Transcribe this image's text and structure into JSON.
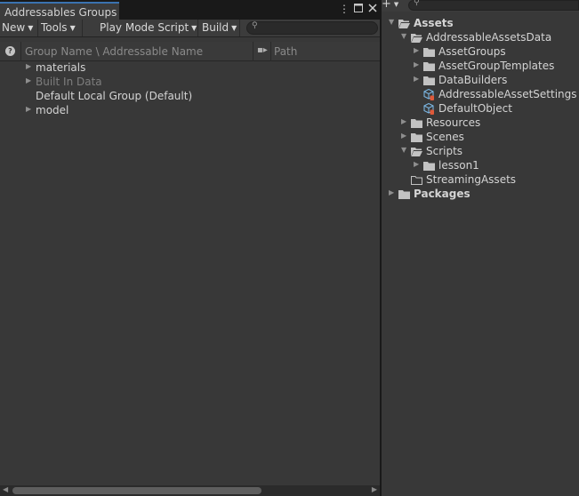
{
  "window": {
    "tab_title": "Addressables Groups",
    "tab_menu_icon": "kebab-menu-icon",
    "maximize_icon": "maximize-icon",
    "close_icon": "close-icon"
  },
  "toolbar": {
    "new_label": "New",
    "tools_label": "Tools",
    "play_mode_label": "Play Mode Script",
    "build_label": "Build",
    "search_placeholder": ""
  },
  "columns": {
    "help_label": "?",
    "group_name": "Group Name \\ Addressable Name",
    "path": "Path"
  },
  "groups": [
    {
      "label": "materials",
      "expandable": true,
      "dim": false
    },
    {
      "label": "Built In Data",
      "expandable": true,
      "dim": true
    },
    {
      "label": "Default Local Group (Default)",
      "expandable": false,
      "dim": false
    },
    {
      "label": "model",
      "expandable": true,
      "dim": false
    }
  ],
  "project": {
    "create_label": "+",
    "search_placeholder": "",
    "tree": [
      {
        "label": "Assets",
        "depth": 0,
        "arrow": "down",
        "icon": "folder-open-icon",
        "bold": true
      },
      {
        "label": "AddressableAssetsData",
        "depth": 1,
        "arrow": "down",
        "icon": "folder-open-icon",
        "bold": false
      },
      {
        "label": "AssetGroups",
        "depth": 2,
        "arrow": "right",
        "icon": "folder-icon",
        "bold": false
      },
      {
        "label": "AssetGroupTemplates",
        "depth": 2,
        "arrow": "right",
        "icon": "folder-icon",
        "bold": false
      },
      {
        "label": "DataBuilders",
        "depth": 2,
        "arrow": "right",
        "icon": "folder-icon",
        "bold": false
      },
      {
        "label": "AddressableAssetSettings",
        "depth": 2,
        "arrow": "",
        "icon": "scriptable-object-icon",
        "bold": false
      },
      {
        "label": "DefaultObject",
        "depth": 2,
        "arrow": "",
        "icon": "scriptable-object-icon",
        "bold": false
      },
      {
        "label": "Resources",
        "depth": 1,
        "arrow": "right",
        "icon": "folder-icon",
        "bold": false
      },
      {
        "label": "Scenes",
        "depth": 1,
        "arrow": "right",
        "icon": "folder-icon",
        "bold": false
      },
      {
        "label": "Scripts",
        "depth": 1,
        "arrow": "down",
        "icon": "folder-open-icon",
        "bold": false
      },
      {
        "label": "lesson1",
        "depth": 2,
        "arrow": "right",
        "icon": "folder-icon",
        "bold": false
      },
      {
        "label": "StreamingAssets",
        "depth": 1,
        "arrow": "",
        "icon": "folder-empty-icon",
        "bold": false
      },
      {
        "label": "Packages",
        "depth": 0,
        "arrow": "right",
        "icon": "folder-icon",
        "bold": true
      }
    ]
  },
  "colors": {
    "panel_bg": "#383838",
    "tab_accent": "#3a72b0",
    "text": "#d4d4d4",
    "dim_text": "#7e7e7e",
    "asset_icon": "#7ab4e0",
    "asset_badge": "#e05a3a"
  }
}
